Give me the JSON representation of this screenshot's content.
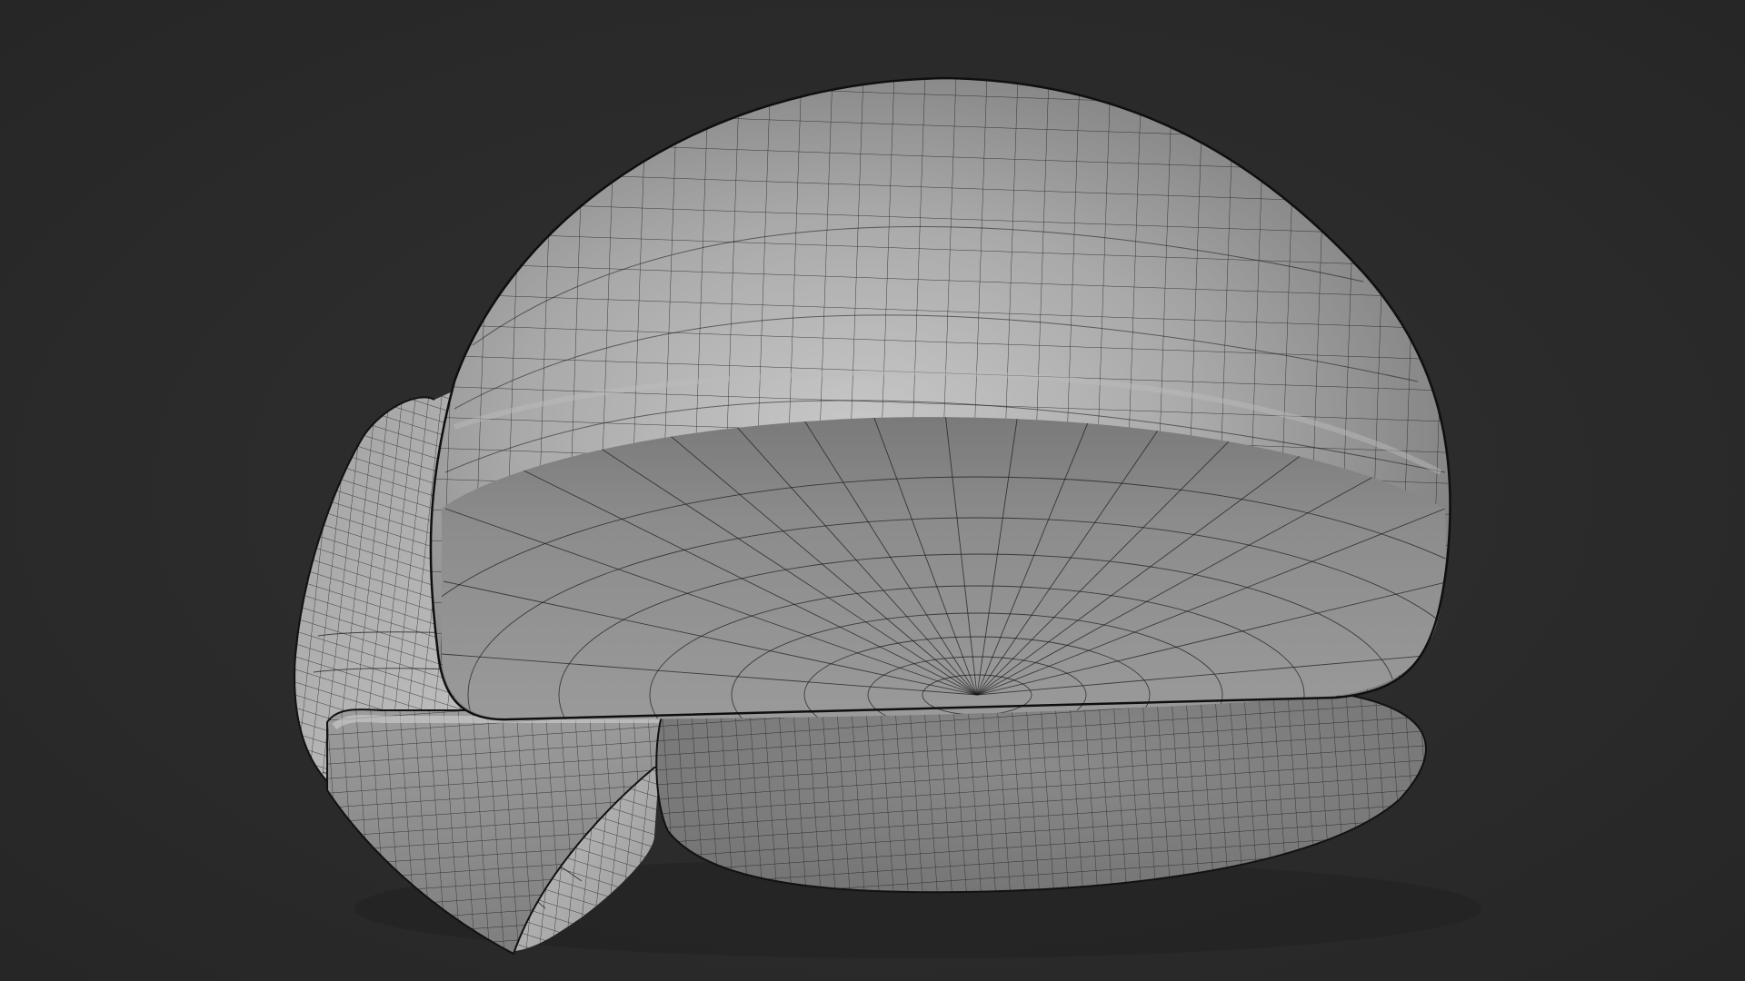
{
  "viewport": {
    "background_color": "#2b2b2b",
    "mesh_color": "#8f8f8f",
    "wire_color": "#111111",
    "display_mode": "solid-wireframe"
  },
  "scene": {
    "objects": [
      {
        "name": "large-rounded-body"
      },
      {
        "name": "side-block"
      },
      {
        "name": "lower-block"
      }
    ]
  }
}
